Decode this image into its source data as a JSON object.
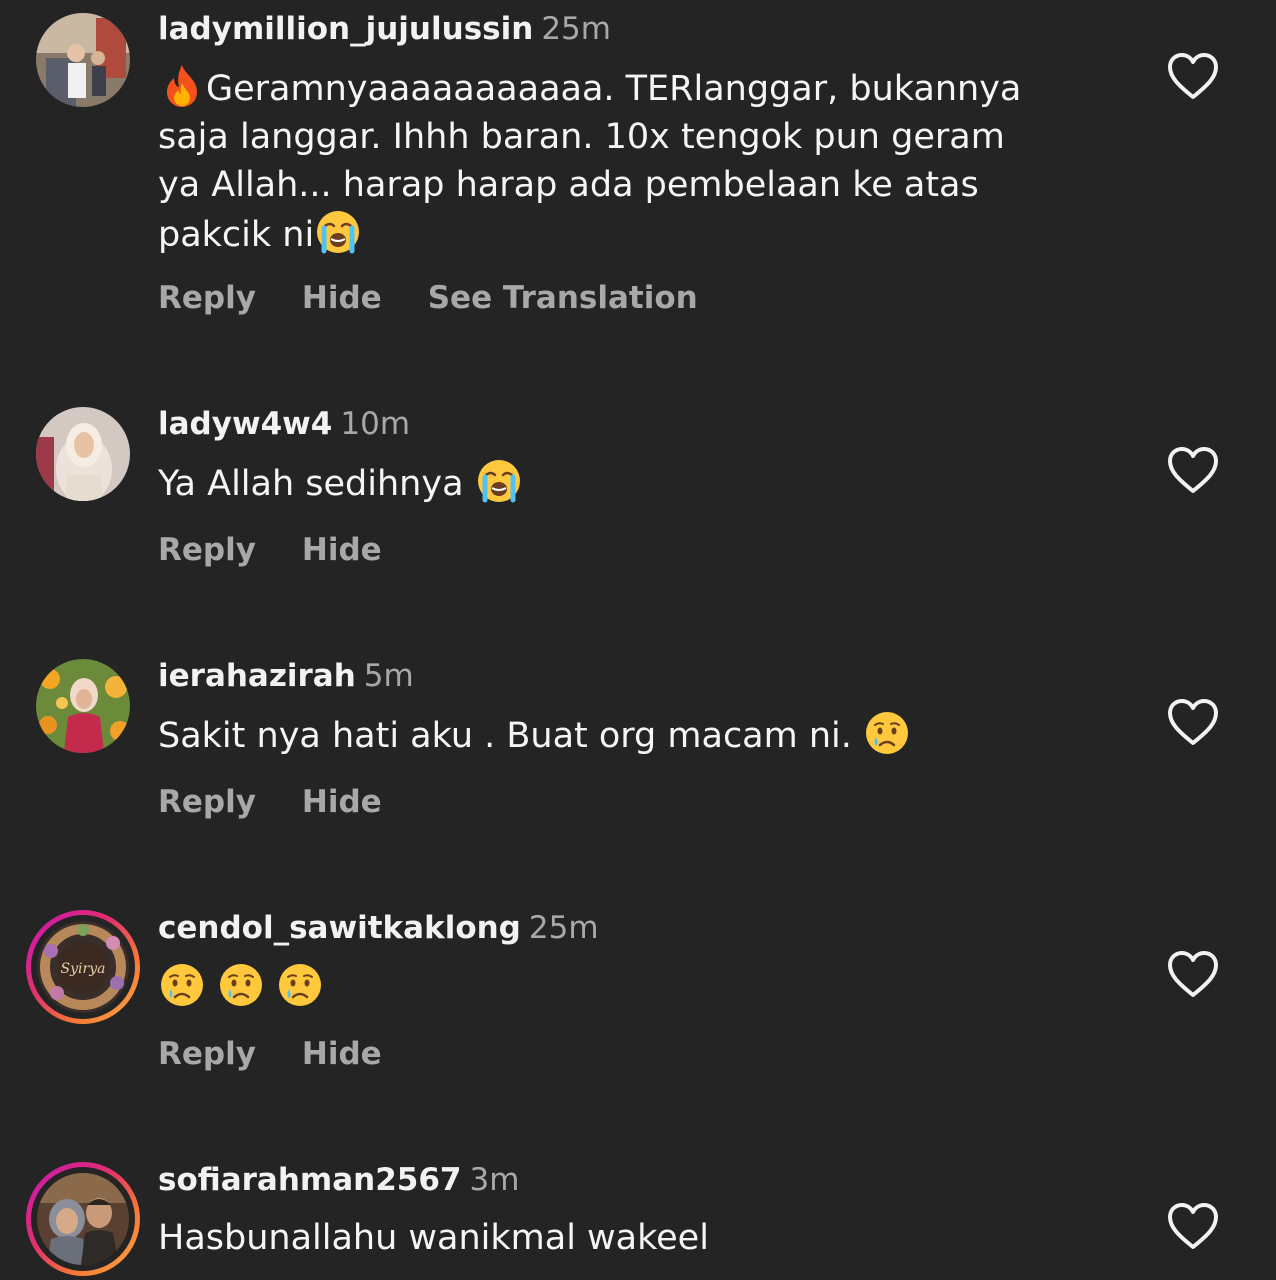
{
  "comments": [
    {
      "username": "ladymillion_jujulussin",
      "time": "25m",
      "text_lines": [
        "Geramnyaaaaaaaaaaa. TERlanggar, bukannya",
        "saja langgar. Ihhh baran. 10x tengok pun geram",
        "ya Allah... harap harap ada pembelaan ke atas",
        "pakcik ni"
      ],
      "emojis": [
        "fire-emoji",
        "crying-face-emoji"
      ],
      "actions": [
        "Reply",
        "Hide",
        "See Translation"
      ],
      "story_ring": false
    },
    {
      "username": "ladyw4w4",
      "time": "10m",
      "text": "Ya Allah sedihnya ",
      "emojis": [
        "crying-face-emoji"
      ],
      "actions": [
        "Reply",
        "Hide"
      ],
      "story_ring": false
    },
    {
      "username": "ierahazirah",
      "time": "5m",
      "text": "Sakit nya hati aku . Buat org macam ni. ",
      "emojis": [
        "sad-tear-emoji"
      ],
      "actions": [
        "Reply",
        "Hide"
      ],
      "story_ring": false
    },
    {
      "username": "cendol_sawitkaklong",
      "time": "25m",
      "text": "",
      "emojis": [
        "sad-tear-emoji",
        "sad-tear-emoji",
        "sad-tear-emoji"
      ],
      "actions": [
        "Reply",
        "Hide"
      ],
      "story_ring": true,
      "avatar_text": "Syirya"
    },
    {
      "username": "sofiarahman2567",
      "time": "3m",
      "text": "Hasbunallahu wanikmal wakeel",
      "emojis": [],
      "actions": [],
      "story_ring": true
    }
  ],
  "icons": {
    "like": "heart-outline-icon"
  },
  "colors": {
    "background": "#242424",
    "secondary_text": "#a8a8a8",
    "primary_text": "#f5f5f5"
  }
}
